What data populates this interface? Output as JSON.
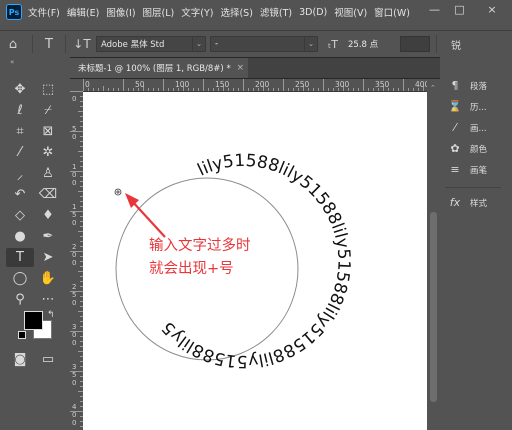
{
  "app": {
    "logo": "Ps"
  },
  "menu": [
    "文件(F)",
    "编辑(E)",
    "图像(I)",
    "图层(L)",
    "文字(Y)",
    "选择(S)",
    "滤镜(T)",
    "3D(D)",
    "视图(V)",
    "窗口(W)"
  ],
  "window_controls": {
    "minimize": "—",
    "restore": "□",
    "close": "×"
  },
  "options_bar": {
    "font_family": "Adobe 黑体 Std",
    "font_style": "-",
    "font_size": "25.8 点",
    "right_label": "锐"
  },
  "document": {
    "tab_title": "未标题-1 @ 100% (图层 1, RGB/8#) *",
    "tab_close": "×",
    "ruler_h_labels": [
      "0",
      "50",
      "100",
      "150",
      "200",
      "250",
      "300",
      "350",
      "400"
    ],
    "ruler_v_labels": [
      "0",
      "5",
      "0",
      "1",
      "0",
      "0",
      "1",
      "5",
      "0",
      "2",
      "0",
      "0",
      "2",
      "5",
      "0",
      "3",
      "0",
      "0",
      "3",
      "5",
      "0",
      "4",
      "0",
      "0"
    ]
  },
  "canvas_content": {
    "path_text": "lily51588lily51588lily51588lily51588lily51588lily5",
    "annotation_line1": "输入文字过多时",
    "annotation_line2": "就会出现+号",
    "annotation_color": "#e8363a"
  },
  "right_panels": [
    {
      "icon": "paragraph-icon",
      "label": "段落"
    },
    {
      "icon": "history-icon",
      "label": "历..."
    },
    {
      "icon": "brush-settings-icon",
      "label": "画..."
    },
    {
      "icon": "color-icon",
      "label": "颜色"
    },
    {
      "icon": "brushes-icon",
      "label": "画笔"
    },
    {
      "icon": "styles-icon",
      "label": "样式"
    }
  ]
}
